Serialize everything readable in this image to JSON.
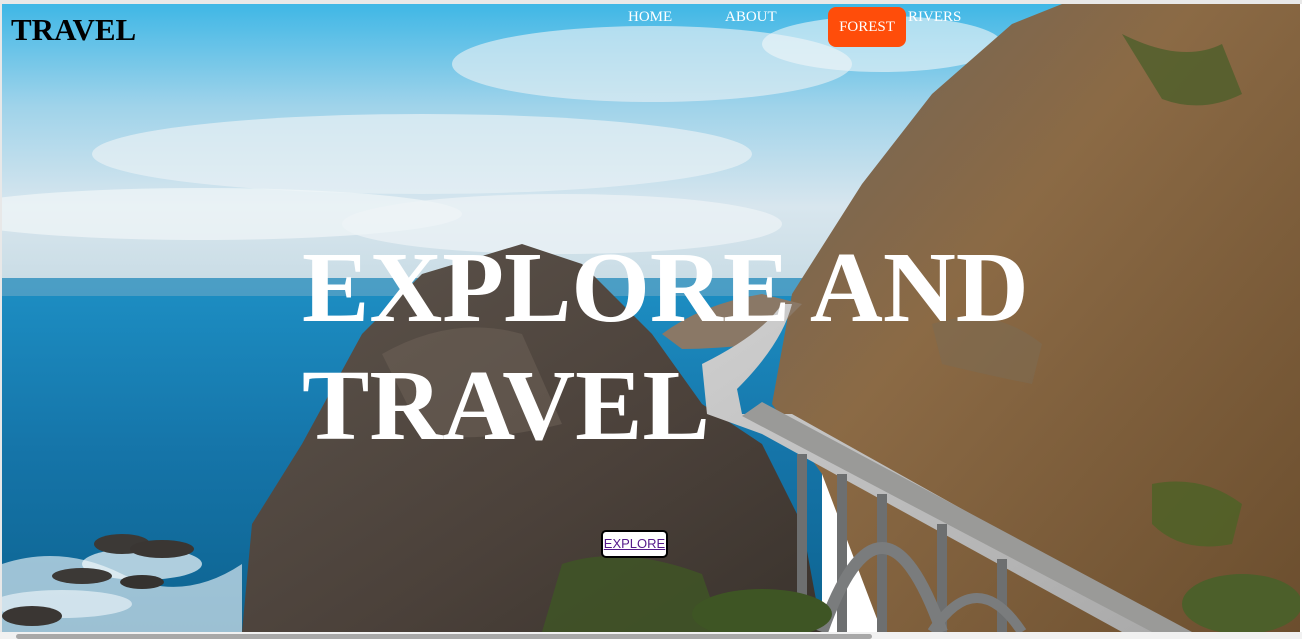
{
  "header": {
    "brand": "TRAVEL"
  },
  "nav": {
    "items": [
      {
        "label": "HOME"
      },
      {
        "label": "ABOUT"
      },
      {
        "label": "FOREST"
      },
      {
        "label": "RIVERS"
      }
    ],
    "active_index": 2,
    "active_color": "#ff4d0a"
  },
  "hero": {
    "headline": "EXPLORE AND TRAVEL",
    "background": "coastal-bridge-photo",
    "cta_label": "EXPLORE"
  },
  "scrollbar": {
    "orientation": "horizontal"
  }
}
